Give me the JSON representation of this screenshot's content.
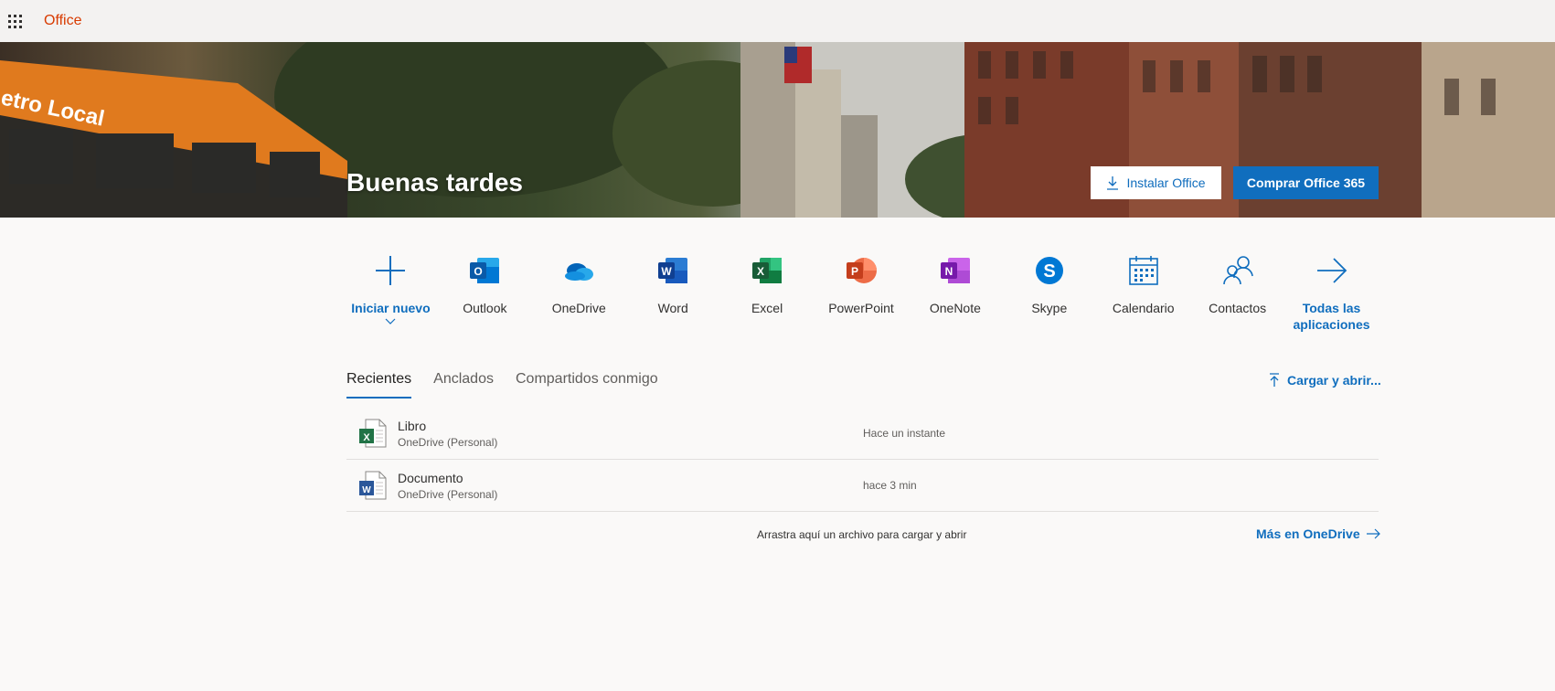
{
  "topbar": {
    "brand": "Office",
    "brand_color": "#d83b01",
    "launcher_icon": "waffle-icon"
  },
  "hero": {
    "greeting": "Buenas tardes",
    "install_label": "Instalar Office",
    "buy_label": "Comprar Office 365",
    "photo_sign": "etro Local"
  },
  "apps": [
    {
      "name": "new",
      "label": "Iniciar nuevo",
      "icon": "plus-icon"
    },
    {
      "name": "outlook",
      "label": "Outlook",
      "icon": "outlook-icon"
    },
    {
      "name": "onedrive",
      "label": "OneDrive",
      "icon": "onedrive-icon"
    },
    {
      "name": "word",
      "label": "Word",
      "icon": "word-icon"
    },
    {
      "name": "excel",
      "label": "Excel",
      "icon": "excel-icon"
    },
    {
      "name": "powerpoint",
      "label": "PowerPoint",
      "icon": "powerpoint-icon"
    },
    {
      "name": "onenote",
      "label": "OneNote",
      "icon": "onenote-icon"
    },
    {
      "name": "skype",
      "label": "Skype",
      "icon": "skype-icon"
    },
    {
      "name": "calendar",
      "label": "Calendario",
      "icon": "calendar-icon"
    },
    {
      "name": "contacts",
      "label": "Contactos",
      "icon": "contacts-icon"
    },
    {
      "name": "all-apps",
      "label": "Todas las aplicaciones",
      "icon": "arrow-right-icon"
    }
  ],
  "tabs": [
    {
      "label": "Recientes",
      "active": true
    },
    {
      "label": "Anclados",
      "active": false
    },
    {
      "label": "Compartidos conmigo",
      "active": false
    }
  ],
  "upload_label": "Cargar y abrir...",
  "files": [
    {
      "name": "Libro",
      "location": "OneDrive (Personal)",
      "time": "Hace un instante",
      "type": "excel"
    },
    {
      "name": "Documento",
      "location": "OneDrive (Personal)",
      "time": "hace 3 min",
      "type": "word"
    }
  ],
  "drop_hint": "Arrastra aquí un archivo para cargar y abrir",
  "more_onedrive": "Más en OneDrive",
  "colors": {
    "accent": "#106ebe",
    "excel": "#217346",
    "word": "#2b579a"
  }
}
